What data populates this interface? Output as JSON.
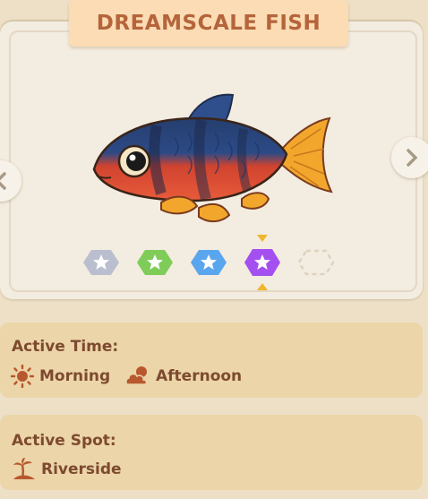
{
  "title": "DREAMSCALE FISH",
  "nav": {
    "prev_icon": "chevron-left-icon",
    "next_icon": "chevron-right-icon"
  },
  "rarity_badges": [
    {
      "color": "#b9bfce",
      "icon": "star-icon"
    },
    {
      "color": "#7fcc59",
      "icon": "star-icon"
    },
    {
      "color": "#5aa6ee",
      "icon": "star-icon"
    },
    {
      "color": "#a44ff0",
      "icon": "star-icon",
      "selected": true
    },
    {
      "color": "#ddd2bf",
      "icon": "empty-slot"
    }
  ],
  "active_time": {
    "label": "Active Time:",
    "items": [
      {
        "icon": "sun-icon",
        "text": "Morning"
      },
      {
        "icon": "cloudy-sun-icon",
        "text": "Afternoon"
      }
    ]
  },
  "active_spot": {
    "label": "Active Spot:",
    "items": [
      {
        "icon": "island-palm-icon",
        "text": "Riverside"
      }
    ]
  },
  "colors": {
    "accent_text": "#7d4a30",
    "title_text": "#b5643b",
    "panel": "#ecd5a8",
    "selected_marker": "#f0b72d"
  }
}
